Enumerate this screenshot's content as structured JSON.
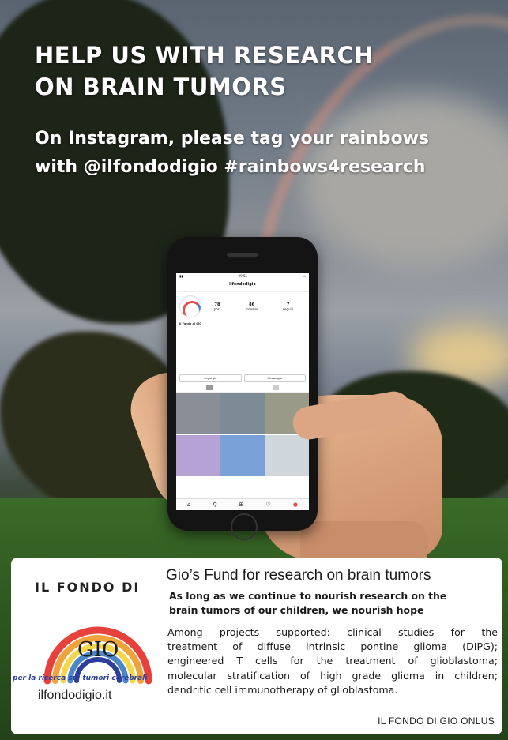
{
  "headline": {
    "line1": "HELP US WITH RESEARCH",
    "line2": "ON BRAIN TUMORS"
  },
  "subline": {
    "line1": "On Instagram, please tag your rainbows",
    "line2": "with @ilfondodigio #rainbows4research"
  },
  "phone": {
    "status_time": "09:55",
    "header": "ilfondodigio",
    "stats": [
      {
        "value": "78",
        "label": "post"
      },
      {
        "value": "86",
        "label": "follower"
      },
      {
        "value": "7",
        "label": "seguiti"
      }
    ],
    "bio_name": "Il Fondo di GIO",
    "button_follow": "Segui già",
    "button_message": "Messaggio",
    "grid_colors": [
      "#8a8f97",
      "#7d8b96",
      "#9a9a88",
      "#b7a2d6",
      "#7aa0d8",
      "#cfd6dc"
    ],
    "nav_icons": [
      "home-icon",
      "search-icon",
      "add-icon",
      "heart-icon",
      "profile-icon"
    ]
  },
  "card": {
    "logo_top": "IL FONDO DI",
    "logo_gio": "GIO",
    "logo_tagline": "per la ricerca sui tumori cerebrali",
    "website": "ilfondodigio.it",
    "title": "Gio’s Fund for research on brain tumors",
    "hope_line1": "As long as we continue to nourish research on the",
    "hope_line2": "brain tumors of our children, we nourish hope",
    "body_line1": "Among projects supported: clinical studies for the",
    "body_line2": "treatment of diffuse intrinsic pontine glioma (DIPG);",
    "body_line3": "engineered T cells for the treatment of glioblastoma;",
    "body_line4": "molecular stratification of high grade glioma in children;",
    "body_line5": "dendritic cell immunotherapy of glioblastoma.",
    "org": "IL FONDO DI GIO ONLUS"
  },
  "colors": {
    "text_on_photo": "#ffffff",
    "card_background": "#ffffff",
    "tagline_blue": "#2b3f9c"
  }
}
